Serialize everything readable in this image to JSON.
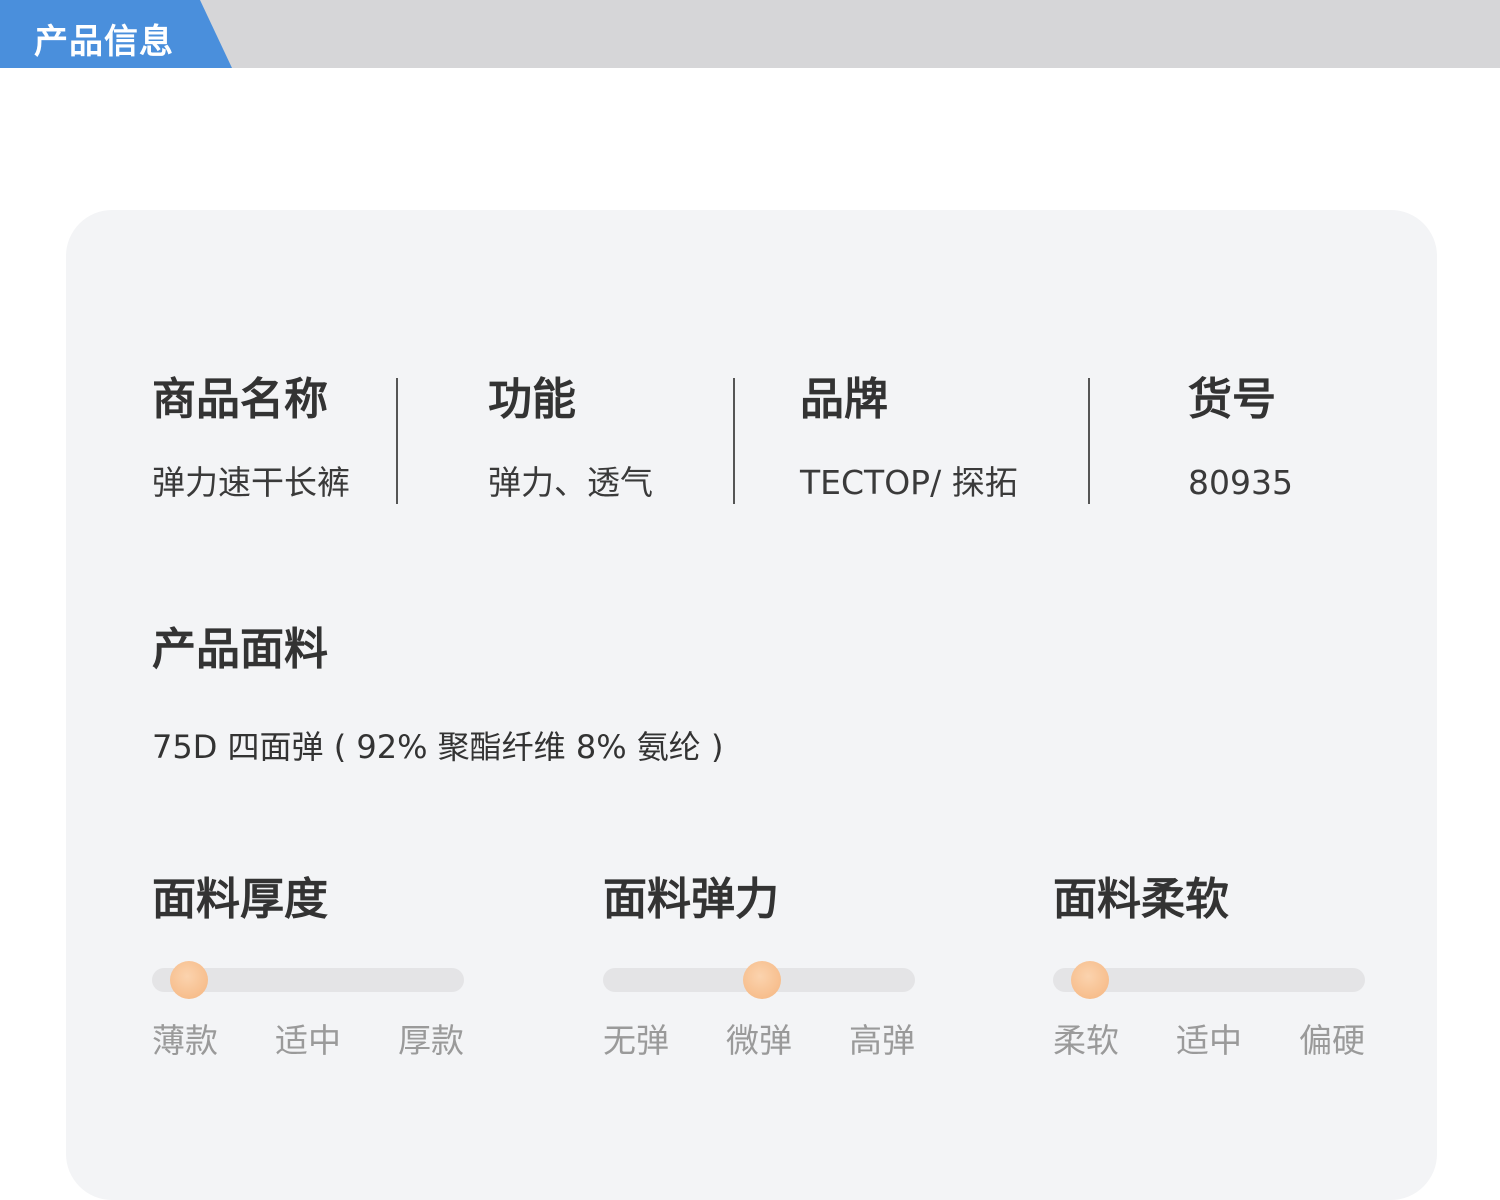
{
  "header": {
    "title": "产品信息"
  },
  "info": [
    {
      "label": "商品名称",
      "value": "弹力速干长裤"
    },
    {
      "label": "功能",
      "value": "弹力、透气"
    },
    {
      "label": "品牌",
      "value": "TECTOP/ 探拓"
    },
    {
      "label": "货号",
      "value": "80935"
    }
  ],
  "material": {
    "label": "产品面料",
    "value": "75D 四面弹 ( 92% 聚酯纤维 8% 氨纶 )"
  },
  "scales": [
    {
      "title": "面料厚度",
      "ticks": [
        "薄款",
        "适中",
        "厚款"
      ],
      "level": 0.12
    },
    {
      "title": "面料弹力",
      "ticks": [
        "无弹",
        "微弹",
        "高弹"
      ],
      "level": 0.51
    },
    {
      "title": "面料柔软",
      "ticks": [
        "柔软",
        "适中",
        "偏硬"
      ],
      "level": 0.12
    }
  ],
  "colors": {
    "accent": "#4a8fdc",
    "knob": "#f5b57f",
    "card": "#f3f4f6"
  }
}
